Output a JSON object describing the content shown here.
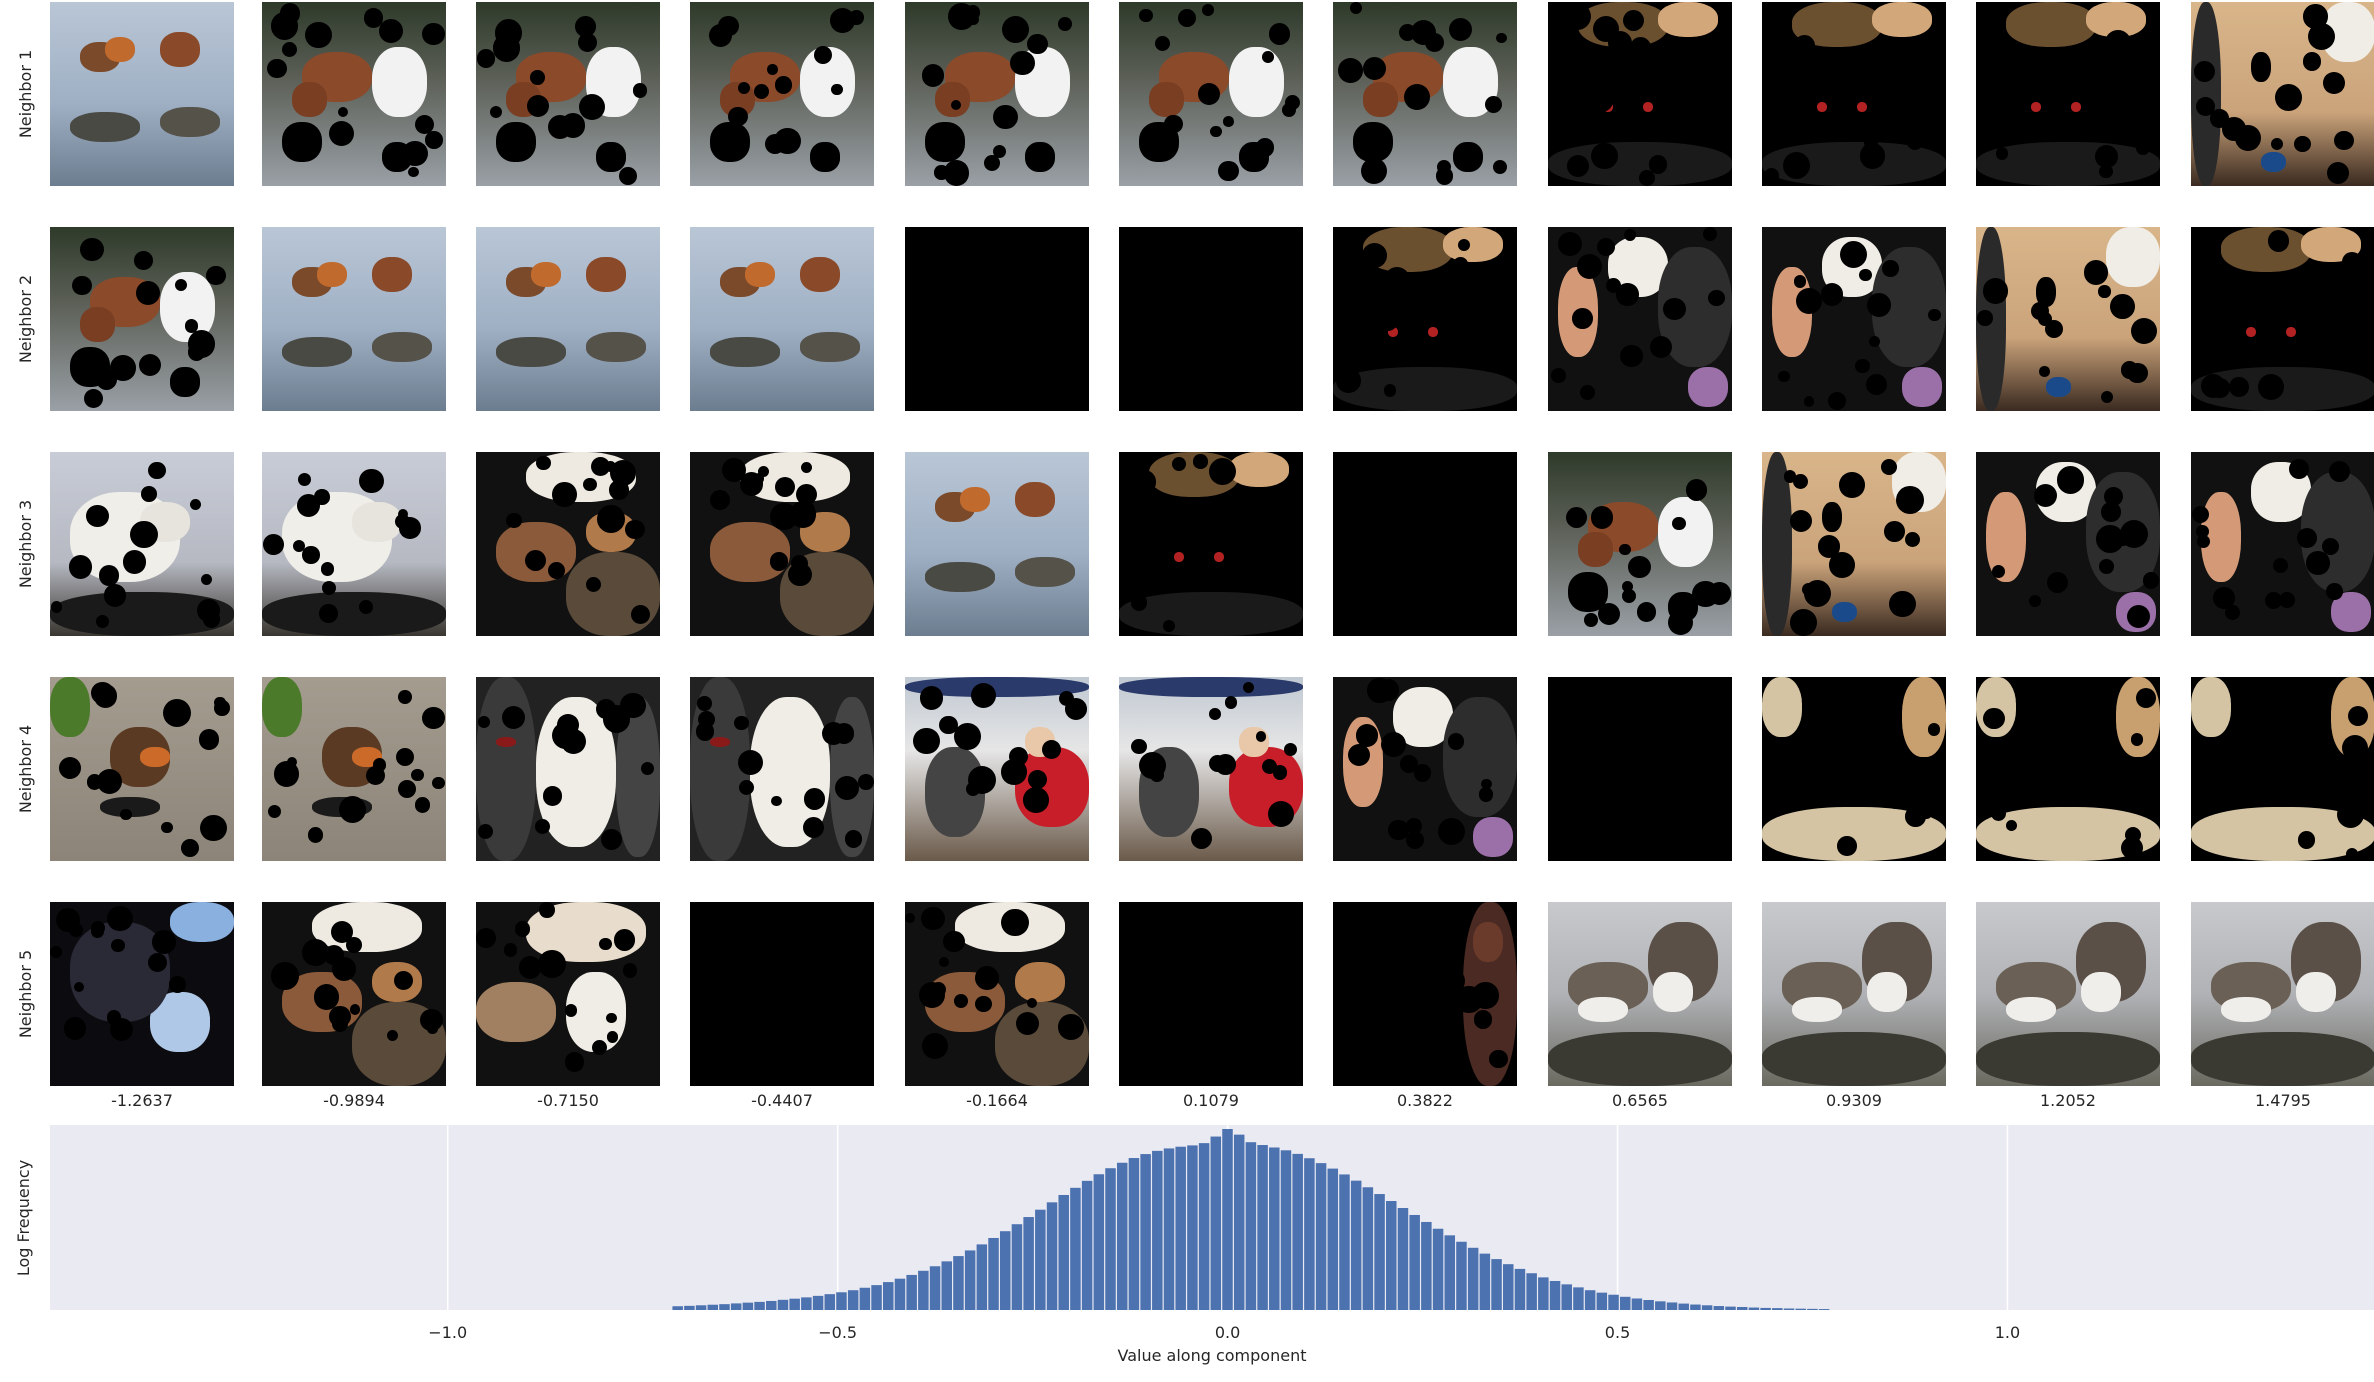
{
  "row_labels": [
    "Neighbor 1",
    "Neighbor 2",
    "Neighbor 3",
    "Neighbor 4",
    "Neighbor 5"
  ],
  "column_values": [
    "-1.2637",
    "-0.9894",
    "-0.7150",
    "-0.4407",
    "-0.1664",
    "0.1079",
    "0.3822",
    "0.6565",
    "0.9309",
    "1.2052",
    "1.4795"
  ],
  "thumbnails": [
    [
      "mergansers-pair",
      "dog-in-water-masked",
      "dog-in-water-masked",
      "dog-in-water-masked",
      "dog-in-water-masked",
      "dog-in-water-masked",
      "dog-in-water-masked",
      "dark-room-red-lights-masked",
      "dark-room-red-lights-masked",
      "dark-room-red-lights-masked",
      "doorway-hanging-masked"
    ],
    [
      "dog-in-water-masked",
      "mergansers-pair",
      "mergansers-pair",
      "mergansers-pair",
      "black",
      "black",
      "dark-room-red-lights-masked",
      "blocks-purple-masked",
      "blocks-purple-masked",
      "doorway-hanging-masked",
      "dark-room-red-lights-masked"
    ],
    [
      "arctic-fox-masked",
      "arctic-fox-masked",
      "chef-food-masked",
      "chef-food-masked",
      "mergansers-pair",
      "dark-room-red-lights-masked",
      "black",
      "dog-in-water-masked",
      "doorway-hanging-masked",
      "blocks-purple-masked",
      "blocks-purple-masked"
    ],
    [
      "sparrow-on-ground-masked",
      "sparrow-on-ground-masked",
      "poodles-masked",
      "poodles-masked",
      "people-by-water-masked",
      "people-by-water-masked",
      "blocks-purple-masked",
      "black",
      "floor-spots-masked",
      "floor-spots-masked",
      "floor-spots-masked"
    ],
    [
      "dark-speckled-masked",
      "chef-food-masked",
      "indoor-object-masked",
      "black",
      "chef-food-masked",
      "black",
      "brick-wall-spots-masked",
      "turnstones-pair",
      "turnstones-pair",
      "turnstones-pair",
      "turnstones-pair"
    ]
  ],
  "chart_data": {
    "type": "bar",
    "title": "",
    "xlabel": "Value along component",
    "ylabel": "Log Frequency",
    "xlim": [
      -1.51,
      1.47
    ],
    "x_ticks": [
      -1.0,
      -0.5,
      0.0,
      0.5,
      1.0
    ],
    "x_tick_labels": [
      "−1.0",
      "−0.5",
      "0.0",
      "0.5",
      "1.0"
    ],
    "grid": true,
    "bin_centers": [
      -0.705,
      -0.69,
      -0.675,
      -0.66,
      -0.645,
      -0.63,
      -0.615,
      -0.6,
      -0.585,
      -0.57,
      -0.555,
      -0.54,
      -0.525,
      -0.51,
      -0.495,
      -0.48,
      -0.465,
      -0.45,
      -0.435,
      -0.42,
      -0.405,
      -0.39,
      -0.375,
      -0.36,
      -0.345,
      -0.33,
      -0.315,
      -0.3,
      -0.285,
      -0.27,
      -0.255,
      -0.24,
      -0.225,
      -0.21,
      -0.195,
      -0.18,
      -0.165,
      -0.15,
      -0.135,
      -0.12,
      -0.105,
      -0.09,
      -0.075,
      -0.06,
      -0.045,
      -0.03,
      -0.015,
      0.0,
      0.015,
      0.03,
      0.045,
      0.06,
      0.075,
      0.09,
      0.105,
      0.12,
      0.135,
      0.15,
      0.165,
      0.18,
      0.195,
      0.21,
      0.225,
      0.24,
      0.255,
      0.27,
      0.285,
      0.3,
      0.315,
      0.33,
      0.345,
      0.36,
      0.375,
      0.39,
      0.405,
      0.42,
      0.435,
      0.45,
      0.465,
      0.48,
      0.495,
      0.51,
      0.525,
      0.54,
      0.555,
      0.57,
      0.585,
      0.6,
      0.615,
      0.63,
      0.645,
      0.66,
      0.675,
      0.69,
      0.705,
      0.72,
      0.735,
      0.75,
      0.765
    ],
    "values": [
      0.02,
      0.022,
      0.025,
      0.028,
      0.031,
      0.035,
      0.039,
      0.043,
      0.048,
      0.054,
      0.06,
      0.067,
      0.075,
      0.084,
      0.094,
      0.105,
      0.118,
      0.132,
      0.148,
      0.166,
      0.186,
      0.208,
      0.232,
      0.258,
      0.286,
      0.316,
      0.348,
      0.382,
      0.418,
      0.455,
      0.493,
      0.532,
      0.571,
      0.61,
      0.648,
      0.685,
      0.72,
      0.752,
      0.781,
      0.806,
      0.827,
      0.844,
      0.857,
      0.866,
      0.873,
      0.885,
      0.92,
      0.96,
      0.93,
      0.89,
      0.875,
      0.862,
      0.847,
      0.828,
      0.805,
      0.779,
      0.75,
      0.719,
      0.686,
      0.651,
      0.615,
      0.578,
      0.541,
      0.504,
      0.467,
      0.431,
      0.396,
      0.362,
      0.33,
      0.299,
      0.27,
      0.243,
      0.218,
      0.195,
      0.173,
      0.154,
      0.136,
      0.12,
      0.105,
      0.092,
      0.081,
      0.07,
      0.061,
      0.053,
      0.046,
      0.04,
      0.034,
      0.029,
      0.025,
      0.021,
      0.018,
      0.016,
      0.013,
      0.011,
      0.01,
      0.008,
      0.007,
      0.006,
      0.005
    ],
    "bar_color": "#4c72b0",
    "background_color": "#eaeaf2"
  },
  "colors": {
    "black": "#000000",
    "grid": "#ffffff"
  }
}
